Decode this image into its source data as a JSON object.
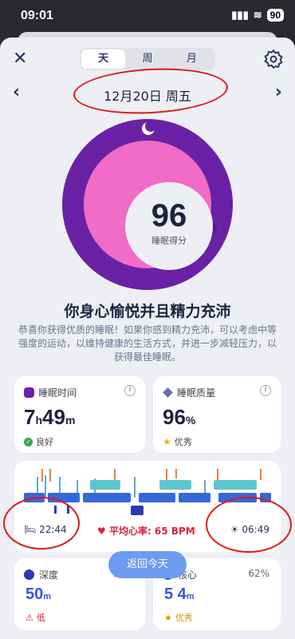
{
  "status_bar": {
    "time": "09:01",
    "signal": "▮▮▮",
    "wifi": "≋",
    "battery": "90"
  },
  "tabs": [
    {
      "label": "天",
      "active": true
    },
    {
      "label": "周",
      "active": false
    },
    {
      "label": "月",
      "active": false
    }
  ],
  "date_nav": {
    "date": "12月20日 周五",
    "prev": "‹",
    "next": "›"
  },
  "score": {
    "value": "96",
    "label": "睡眠得分"
  },
  "headline": "你身心愉悦并且精力充沛",
  "description": "恭喜你获得优质的睡眠！如果你感到精力充沛，可以考虑中等强度的运动，以维持健康的生活方式，并进一步减轻压力，以获得最佳睡眠。",
  "sleep_time": {
    "title": "睡眠时间",
    "hours": "7",
    "h_unit": "h",
    "minutes": "49",
    "m_unit": "m",
    "status": "良好"
  },
  "sleep_quality": {
    "title": "睡眠质量",
    "value": "96",
    "unit": "%",
    "status": "优秀"
  },
  "hypnogram": {
    "start": "22:44",
    "heart_rate": "平均心率: 65 BPM",
    "end": "06:49"
  },
  "deep": {
    "title": "深度",
    "percent": "10%",
    "value": "50",
    "unit": "m",
    "status": "低"
  },
  "core": {
    "title": "核心",
    "percent": "62%",
    "value": "5 4",
    "unit": "m",
    "status": "优秀"
  },
  "back_today": "返回今天",
  "colors": {
    "ring_outer": "#6a21a6",
    "ring_inner": "#f06cc6",
    "accent_blue": "#3359d6",
    "annotation_red": "#e01818"
  }
}
